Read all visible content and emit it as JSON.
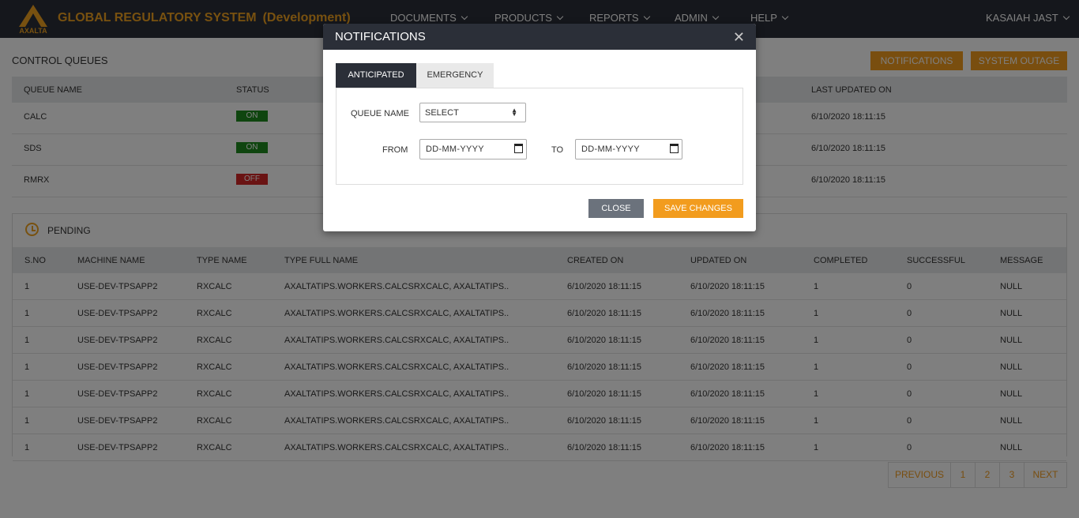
{
  "header": {
    "brand": "AXALTA",
    "title": "GLOBAL REGULATORY SYSTEM",
    "environment": "(Development)",
    "nav": [
      "DOCUMENTS",
      "PRODUCTS",
      "REPORTS",
      "ADMIN",
      "HELP"
    ],
    "user": "KASAIAH JAST"
  },
  "page": {
    "title": "CONTROL QUEUES",
    "notifications_button": "NOTIFICATIONS",
    "outage_button": "SYSTEM OUTAGE"
  },
  "control_queues": {
    "columns": [
      "QUEUE NAME",
      "STATUS",
      "LAST UPDATED ON"
    ],
    "rows": [
      {
        "name": "CALC",
        "status": "ON",
        "updated": "6/10/2020 18:11:15"
      },
      {
        "name": "SDS",
        "status": "ON",
        "updated": "6/10/2020 18:11:15"
      },
      {
        "name": "RMRX",
        "status": "OFF",
        "updated": "6/10/2020 18:11:15"
      }
    ]
  },
  "pending": {
    "title": "PENDING",
    "columns": [
      "S.NO",
      "MACHINE NAME",
      "TYPE NAME",
      "TYPE FULL NAME",
      "CREATED ON",
      "UPDATED ON",
      "COMPLETED",
      "SUCCESSFUL",
      "MESSAGE"
    ],
    "rows": [
      [
        "1",
        "USE-DEV-TPSAPP2",
        "RXCALC",
        "AXALTATIPS.WORKERS.CALCSRXCALC, AXALTATIPS..",
        "6/10/2020 18:11:15",
        "6/10/2020 18:11:15",
        "1",
        "0",
        "NULL"
      ],
      [
        "1",
        "USE-DEV-TPSAPP2",
        "RXCALC",
        "AXALTATIPS.WORKERS.CALCSRXCALC, AXALTATIPS..",
        "6/10/2020 18:11:15",
        "6/10/2020 18:11:15",
        "1",
        "0",
        "NULL"
      ],
      [
        "1",
        "USE-DEV-TPSAPP2",
        "RXCALC",
        "AXALTATIPS.WORKERS.CALCSRXCALC, AXALTATIPS..",
        "6/10/2020 18:11:15",
        "6/10/2020 18:11:15",
        "1",
        "0",
        "NULL"
      ],
      [
        "1",
        "USE-DEV-TPSAPP2",
        "RXCALC",
        "AXALTATIPS.WORKERS.CALCSRXCALC, AXALTATIPS..",
        "6/10/2020 18:11:15",
        "6/10/2020 18:11:15",
        "1",
        "0",
        "NULL"
      ],
      [
        "1",
        "USE-DEV-TPSAPP2",
        "RXCALC",
        "AXALTATIPS.WORKERS.CALCSRXCALC, AXALTATIPS..",
        "6/10/2020 18:11:15",
        "6/10/2020 18:11:15",
        "1",
        "0",
        "NULL"
      ],
      [
        "1",
        "USE-DEV-TPSAPP2",
        "RXCALC",
        "AXALTATIPS.WORKERS.CALCSRXCALC, AXALTATIPS..",
        "6/10/2020 18:11:15",
        "6/10/2020 18:11:15",
        "1",
        "0",
        "NULL"
      ],
      [
        "1",
        "USE-DEV-TPSAPP2",
        "RXCALC",
        "AXALTATIPS.WORKERS.CALCSRXCALC, AXALTATIPS..",
        "6/10/2020 18:11:15",
        "6/10/2020 18:11:15",
        "1",
        "0",
        "NULL"
      ]
    ]
  },
  "pagination": [
    "PREVIOUS",
    "1",
    "2",
    "3",
    "NEXT"
  ],
  "modal": {
    "title": "NOTIFICATIONS",
    "close_icon": "close-icon",
    "tabs": [
      "ANTICIPATED",
      "EMERGENCY"
    ],
    "queue_label": "QUEUE NAME",
    "queue_value": "SELECT",
    "from_label": "FROM",
    "to_label": "TO",
    "from_value": "DD-MM-YYYY",
    "to_value": "DD-MM-YYYY",
    "close_button": "CLOSE",
    "save_button": "SAVE CHANGES"
  },
  "colors": {
    "accent": "#f29c1e",
    "topbar": "#2b2f38",
    "on": "#1e8a1e",
    "off": "#d42626"
  }
}
